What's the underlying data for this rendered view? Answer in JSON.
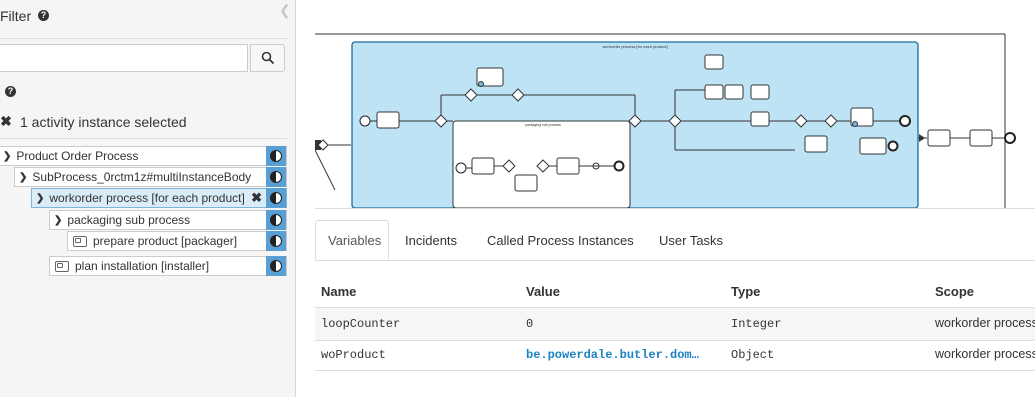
{
  "filter": {
    "title": "Filter",
    "search_placeholder": ""
  },
  "selection": {
    "text": "1 activity instance selected"
  },
  "tree": {
    "root": "Product Order Process",
    "mi_body": "SubProcess_0rctm1z#multiInstanceBody",
    "workorder": "workorder process [for each product]",
    "packaging": "packaging sub process",
    "prepare": "prepare product [packager]",
    "plan": "plan installation [installer]"
  },
  "diagram": {
    "pool_label": "workorder process [for each product]",
    "subprocess_label": "packaging sub process"
  },
  "tabs": [
    "Variables",
    "Incidents",
    "Called Process Instances",
    "User Tasks"
  ],
  "table": {
    "headers": [
      "Name",
      "Value",
      "Type",
      "Scope"
    ],
    "rows": [
      [
        "loopCounter",
        "0",
        "Integer",
        "workorder process"
      ],
      [
        "woProduct",
        "be.powerdale.butler.dom…",
        "Object",
        "workorder process"
      ]
    ]
  },
  "colors": {
    "accent": "#5a9fd4",
    "pool_fill": "#bde3f5",
    "link": "#1c82c1"
  }
}
